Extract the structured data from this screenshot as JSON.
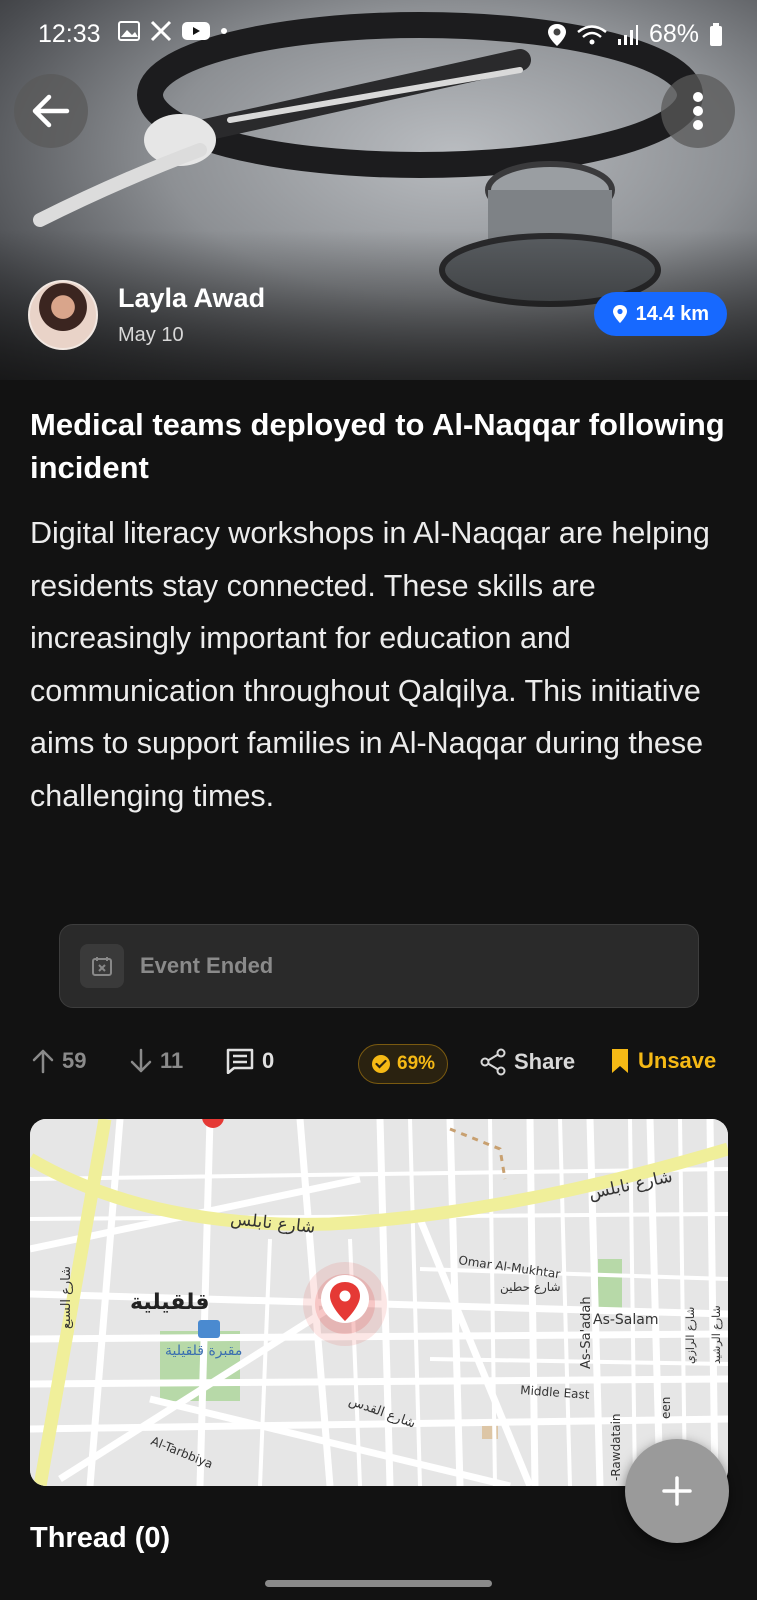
{
  "status_bar": {
    "time": "12:33",
    "battery": "68%"
  },
  "post": {
    "author_name": "Layla Awad",
    "date": "May 10",
    "distance": "14.4 km",
    "title": "Medical teams deployed to Al-Naqqar following incident",
    "body": "Digital literacy workshops in Al-Naqqar are helping residents stay connected. These skills are increasingly important for education and communication throughout Qalqilya. This initiative aims to support families in Al-Naqqar during these challenging times.",
    "event_status": "Event Ended"
  },
  "actions": {
    "upvotes": "59",
    "downvotes": "11",
    "comments": "0",
    "trust_score": "69%",
    "share_label": "Share",
    "unsave_label": "Unsave"
  },
  "map": {
    "labels": {
      "nablus_street_1": "شارع نابلس",
      "nablus_street_2": "شارع نابلس",
      "qalqilya": "قلقيلية",
      "cemetery": "مقبرة قلقيلية",
      "omar_mukhtar": "Omar Al-Mukhtar",
      "hattin_street": "شارع حطين",
      "as_saadah": "As-Sa'adah",
      "as_salam": "As-Salam",
      "middle_east": "Middle East",
      "quds_street": "شارع القدس",
      "al_tarbbiya": "Al-Tarbbiya",
      "sabea_street": "شارع السبع",
      "rawdatain": "-Rawdatain",
      "razi_street": "شارع الرازي",
      "rashid_street": "شارع الرشيد",
      "een": "een"
    }
  },
  "thread": {
    "title": "Thread (0)"
  },
  "colors": {
    "accent_blue": "#1769ff",
    "gold": "#f5b915",
    "marker_red": "#e53935"
  }
}
